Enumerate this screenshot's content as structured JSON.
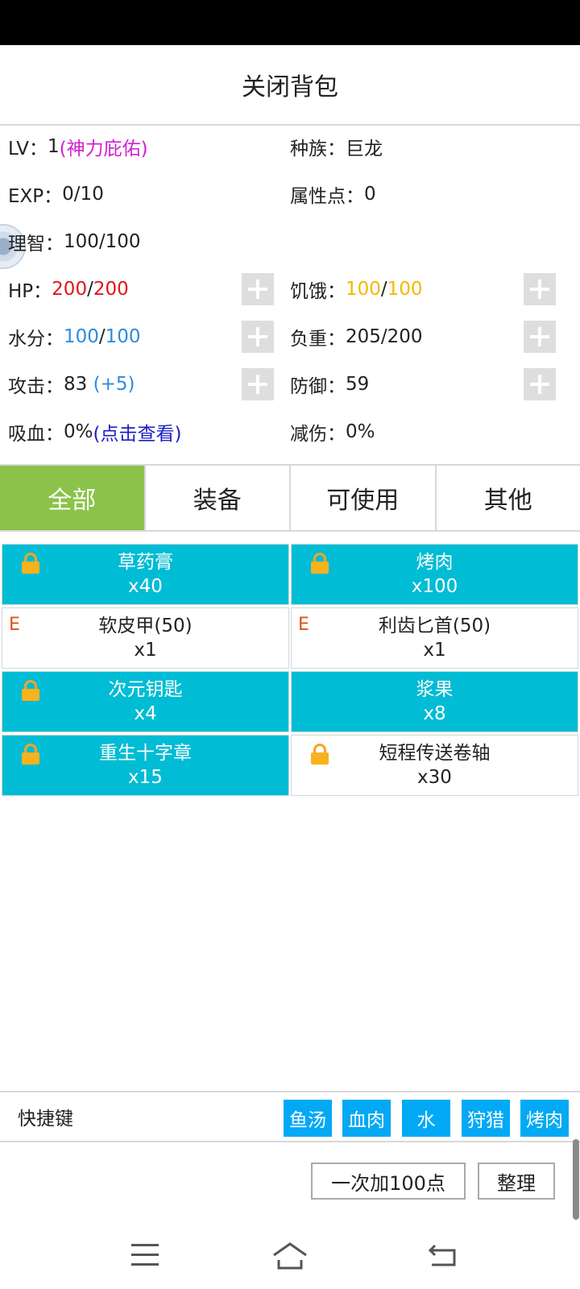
{
  "header": {
    "title": "关闭背包"
  },
  "stats": {
    "lv_label": "LV：",
    "lv_value": "1",
    "lv_blessing": "(神力庇佑)",
    "race_label": "种族：",
    "race_value": "巨龙",
    "exp_label": "EXP：",
    "exp_value": "0/10",
    "attr_label": "属性点：",
    "attr_value": "0",
    "sanity_label": "理智：",
    "sanity_value": "100/100",
    "hp_label": "HP：",
    "hp_current": "200",
    "hp_max": "200",
    "hunger_label": "饥饿：",
    "hunger_current": "100",
    "hunger_max": "100",
    "water_label": "水分：",
    "water_current": "100",
    "water_max": "100",
    "load_label": "负重：",
    "load_value": "205/200",
    "attack_label": "攻击：",
    "attack_value": "83",
    "attack_bonus": "(+5)",
    "defense_label": "防御：",
    "defense_value": "59",
    "lifesteal_label": "吸血：",
    "lifesteal_value": "0%",
    "lifesteal_link": "(点击查看)",
    "reduction_label": "减伤：",
    "reduction_value": "0%",
    "slash": "/"
  },
  "tabs": [
    {
      "label": "全部",
      "active": true
    },
    {
      "label": "装备",
      "active": false
    },
    {
      "label": "可使用",
      "active": false
    },
    {
      "label": "其他",
      "active": false
    }
  ],
  "items": [
    {
      "name": "草药膏",
      "qty": "x40",
      "style": "cyan",
      "mark": "lock"
    },
    {
      "name": "烤肉",
      "qty": "x100",
      "style": "cyan",
      "mark": "lock"
    },
    {
      "name": "软皮甲(50)",
      "qty": "x1",
      "style": "white",
      "mark": "E"
    },
    {
      "name": "利齿匕首(50)",
      "qty": "x1",
      "style": "white",
      "mark": "E"
    },
    {
      "name": "次元钥匙",
      "qty": "x4",
      "style": "cyan",
      "mark": "lock"
    },
    {
      "name": "浆果",
      "qty": "x8",
      "style": "cyan",
      "mark": ""
    },
    {
      "name": "重生十字章",
      "qty": "x15",
      "style": "cyan",
      "mark": "lock"
    },
    {
      "name": "短程传送卷轴",
      "qty": "x30",
      "style": "white",
      "mark": "lock"
    }
  ],
  "shortcuts": {
    "label": "快捷键",
    "buttons": [
      "鱼汤",
      "血肉",
      "水",
      "狩猎",
      "烤肉"
    ]
  },
  "actions": {
    "add100": "一次加100点",
    "sort": "整理"
  },
  "colors": {
    "active_tab": "#8bc34a",
    "item_cyan": "#00bcd4",
    "shortcut_blue": "#03a9f4",
    "hp": "#e0161b",
    "hunger": "#f5b700",
    "water": "#2a8ce0"
  }
}
